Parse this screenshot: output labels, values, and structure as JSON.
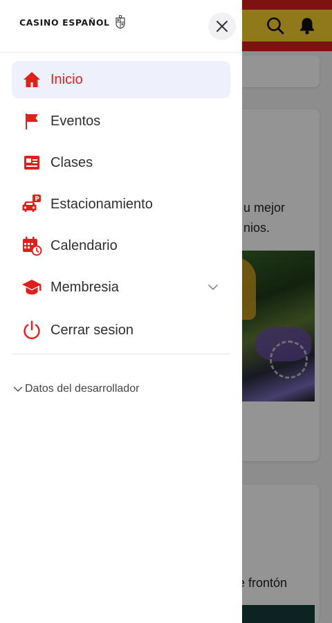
{
  "background": {
    "card_text_1": "u mejor",
    "card_text_2": "nios.",
    "card_text_3": "e frontón"
  },
  "drawer": {
    "brand": "CASINO ESPAÑOL",
    "nav": [
      {
        "label": "Inicio",
        "icon": "home-icon",
        "active": true
      },
      {
        "label": "Eventos",
        "icon": "flag-icon"
      },
      {
        "label": "Clases",
        "icon": "id-card-icon"
      },
      {
        "label": "Estacionamiento",
        "icon": "parking-car-icon"
      },
      {
        "label": "Calendario",
        "icon": "calendar-clock-icon"
      },
      {
        "label": "Membresia",
        "icon": "graduation-cap-icon",
        "expandable": true
      },
      {
        "label": "Cerrar sesion",
        "icon": "power-icon"
      }
    ],
    "developer": "Datos del desarrollador"
  },
  "colors": {
    "accent": "#e0201c",
    "active_bg": "#eef0fb",
    "header_red": "#d6221d",
    "header_yellow": "#f6d130"
  }
}
